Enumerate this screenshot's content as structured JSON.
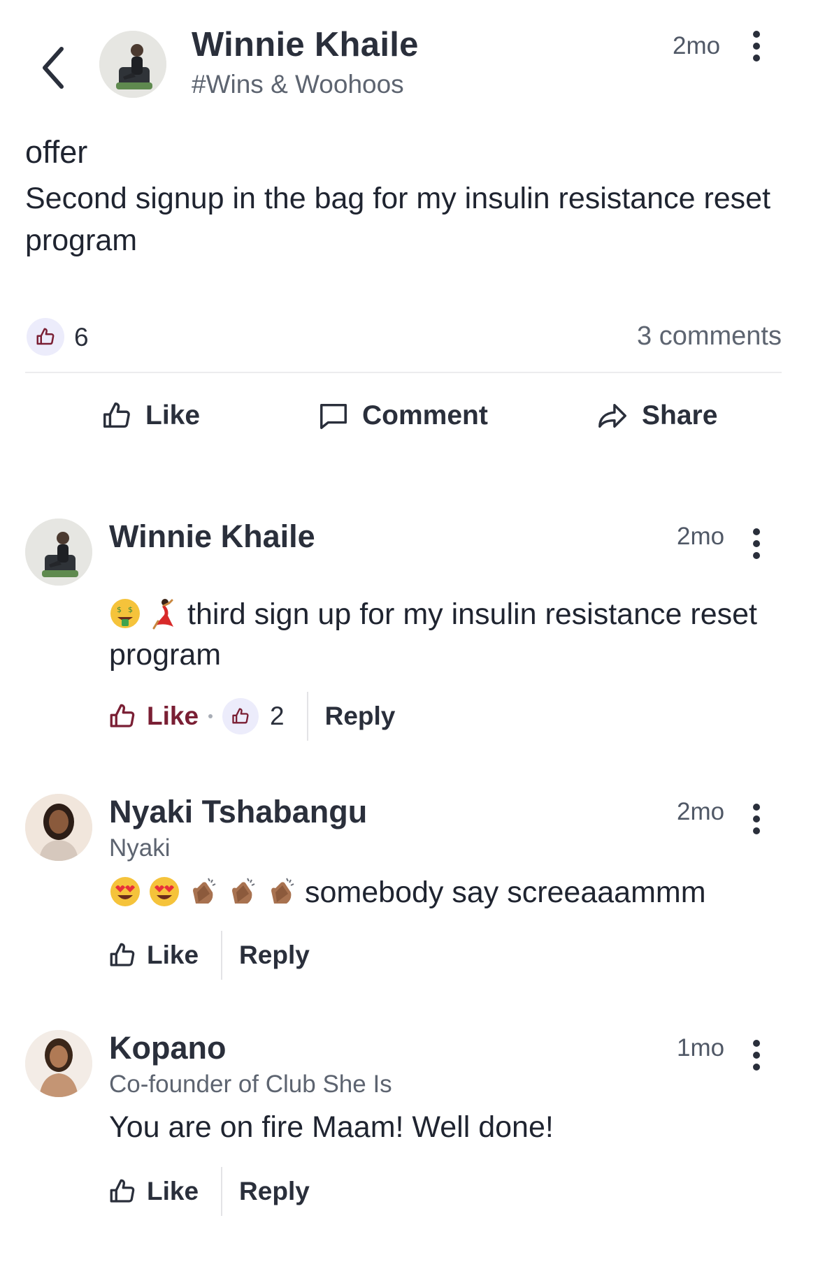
{
  "post": {
    "author": "Winnie Khaile",
    "channel": "#Wins & Woohoos",
    "time": "2mo",
    "title": "offer",
    "body": "Second signup in the bag for my insulin resistance reset program",
    "like_count": "6",
    "comments_count": "3 comments"
  },
  "actions": {
    "like": "Like",
    "comment": "Comment",
    "share": "Share"
  },
  "comments": [
    {
      "author": "Winnie Khaile",
      "subtitle": "",
      "time": "2mo",
      "emojis": [
        "money-mouth-face",
        "dancer"
      ],
      "text": "third sign up for my insulin resistance reset program",
      "like": "Like",
      "like_count": "2",
      "liked": true,
      "reply": "Reply"
    },
    {
      "author": "Nyaki Tshabangu",
      "subtitle": "Nyaki",
      "time": "2mo",
      "emojis": [
        "heart-eyes",
        "heart-eyes",
        "clapping-hands",
        "clapping-hands",
        "clapping-hands"
      ],
      "text": "somebody say screeaaammm",
      "like": "Like",
      "reply": "Reply"
    },
    {
      "author": "Kopano",
      "subtitle": "Co-founder of Club She Is",
      "time": "1mo",
      "text": "You are on fire Maam! Well done!",
      "like": "Like",
      "reply": "Reply"
    }
  ],
  "colors": {
    "accent_like": "#7a1f34",
    "badge_bg": "#ececfb",
    "icon_blue": "#7a1f34"
  }
}
